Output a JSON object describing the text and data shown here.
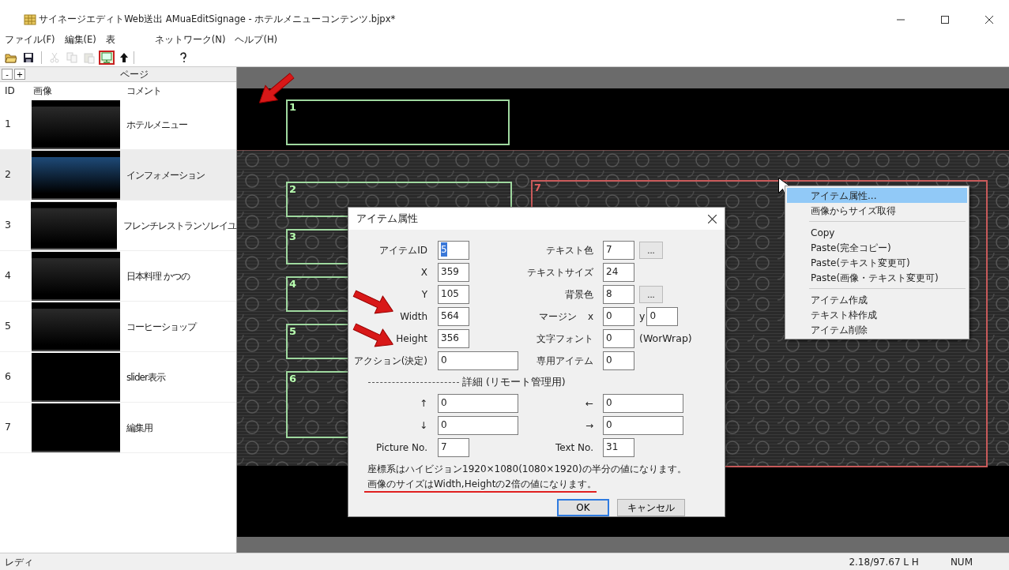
{
  "window": {
    "title": "サイネージエディトWeb送出 AMuaEditSignage - ホテルメニューコンテンツ.bjpx*"
  },
  "menu": [
    "ファイル(F)",
    "編集(E)",
    "表",
    "ネットワーク(N)",
    "ヘルプ(H)"
  ],
  "toolbar": [
    {
      "kind": "open",
      "disabled": false,
      "highlighted": false
    },
    {
      "kind": "save",
      "disabled": false,
      "highlighted": false
    },
    {
      "kind": "separator"
    },
    {
      "kind": "cut",
      "disabled": true,
      "highlighted": false
    },
    {
      "kind": "copy",
      "disabled": true,
      "highlighted": false
    },
    {
      "kind": "paste",
      "disabled": true,
      "highlighted": false
    },
    {
      "kind": "monitor",
      "disabled": false,
      "highlighted": true
    },
    {
      "kind": "upload",
      "disabled": false,
      "highlighted": false
    },
    {
      "kind": "separator"
    },
    {
      "kind": "help",
      "disabled": false,
      "highlighted": false
    }
  ],
  "page_panel": {
    "tree_buttons": [
      "-",
      "+"
    ],
    "header": "ページ",
    "columns": [
      "ID",
      "画像",
      "コメント"
    ],
    "rows": [
      {
        "id": "1",
        "color": "#2a2a2a",
        "comment": "ホテルメニュー",
        "selected": false
      },
      {
        "id": "2",
        "color": "#1e4a78",
        "comment": "インフォメーション",
        "selected": true
      },
      {
        "id": "3",
        "color": "#2a2a2a",
        "comment": "フレンチレストランソレイユ",
        "selected": false
      },
      {
        "id": "4",
        "color": "#2a2a2a",
        "comment": "日本料理 かつの",
        "selected": false
      },
      {
        "id": "5",
        "color": "#2a2a2a",
        "comment": "コーヒーショップ",
        "selected": false
      },
      {
        "id": "6",
        "color": "#000000",
        "comment": "slider表示",
        "selected": false
      },
      {
        "id": "7",
        "color": "#000000",
        "comment": "編集用",
        "selected": false
      }
    ]
  },
  "canvas": {
    "items": [
      {
        "label": "1",
        "selected": false
      },
      {
        "label": "2",
        "selected": false
      },
      {
        "label": "3",
        "selected": false
      },
      {
        "label": "4",
        "selected": false
      },
      {
        "label": "5",
        "selected": false
      },
      {
        "label": "6",
        "selected": false
      },
      {
        "label": "7",
        "selected": true
      }
    ]
  },
  "dialog": {
    "title": "アイテム属性",
    "rows": [
      {
        "kind": "fields",
        "left": {
          "label": "アイテムID",
          "value": "5",
          "text_selected": true
        },
        "right": {
          "label": "テキスト色",
          "value": "7",
          "button": "..."
        }
      },
      {
        "kind": "fields",
        "left": {
          "label": "X",
          "value": "359",
          "text_selected": false
        },
        "right": {
          "label": "テキストサイズ",
          "value": "24"
        }
      },
      {
        "kind": "fields",
        "left": {
          "label": "Y",
          "value": "105",
          "text_selected": false
        },
        "right": {
          "label": "背景色",
          "value": "8",
          "button": "..."
        }
      },
      {
        "kind": "fields",
        "left": {
          "label": "Width",
          "value": "564",
          "text_selected": false
        },
        "right": {
          "label": "マージン",
          "axis": "x",
          "value": "0",
          "second_axis": "y",
          "second_value": "0"
        }
      },
      {
        "kind": "fields",
        "left": {
          "label": "Height",
          "value": "356",
          "text_selected": false
        },
        "right": {
          "label": "文字フォント",
          "value": "0",
          "note": "(WorWrap)"
        }
      },
      {
        "kind": "fields",
        "left": {
          "label": "アクション(決定)",
          "value": "0",
          "wide": true,
          "text_selected": false
        },
        "right": {
          "label": "専用アイテム",
          "value": "0"
        }
      },
      {
        "kind": "section",
        "text": "詳細 (リモート管理用)"
      },
      {
        "kind": "fields",
        "left": {
          "label": "↑",
          "value": "0",
          "wide": true,
          "text_selected": false
        },
        "right": {
          "label": "←",
          "value": "0",
          "wide": true
        }
      },
      {
        "kind": "fields",
        "left": {
          "label": "↓",
          "value": "0",
          "wide": true,
          "text_selected": false
        },
        "right": {
          "label": "→",
          "value": "0",
          "wide": true
        }
      },
      {
        "kind": "fields",
        "left": {
          "label": "Picture No.",
          "value": "7",
          "text_selected": false
        },
        "right": {
          "label": "Text No.",
          "value": "31"
        }
      }
    ],
    "notes": [
      {
        "text": "座標系はハイビジョン1920×1080(1080×1920)の半分の値になります。",
        "underlined": false
      },
      {
        "text": "画像のサイズはWidth,Heightの2倍の値になります。",
        "underlined": true
      }
    ],
    "buttons": [
      {
        "label": "OK",
        "default": true
      },
      {
        "label": "キャンセル",
        "default": false
      }
    ]
  },
  "context_menu": {
    "groups": [
      [
        {
          "label": "アイテム属性...",
          "selected": true
        },
        {
          "label": "画像からサイズ取得",
          "selected": false
        }
      ],
      [
        {
          "label": "Copy",
          "selected": false
        },
        {
          "label": "Paste(完全コピー)",
          "selected": false
        },
        {
          "label": "Paste(テキスト変更可)",
          "selected": false
        },
        {
          "label": "Paste(画像・テキスト変更可)",
          "selected": false
        }
      ],
      [
        {
          "label": "アイテム作成",
          "selected": false
        },
        {
          "label": "テキスト枠作成",
          "selected": false
        },
        {
          "label": "アイテム削除",
          "selected": false
        }
      ]
    ]
  },
  "status_bar": [
    "レディ",
    "2.18/97.67 L H",
    "NUM"
  ]
}
